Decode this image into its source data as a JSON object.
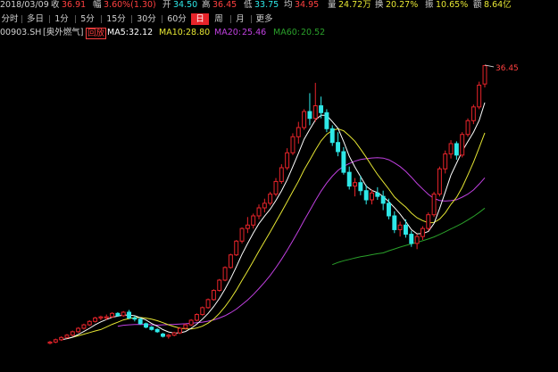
{
  "quote": {
    "date": "2018/03/09",
    "close_label": "收",
    "close": "36.91",
    "change_label": "幅",
    "change": "3.60%(1.30)",
    "open_label": "开",
    "open": "34.50",
    "high_label": "高",
    "high": "36.45",
    "low_label": "低",
    "low": "33.75",
    "avg_label": "均",
    "avg": "34.95",
    "volume_label": "量",
    "volume": "24.72万",
    "turnover_label": "换",
    "turnover": "20.27%",
    "amplitude_label": "振",
    "amplitude": "10.65%",
    "amount_label": "额",
    "amount": "8.64亿"
  },
  "periods": [
    {
      "label": "分时"
    },
    {
      "label": "多日"
    },
    {
      "label": "1分"
    },
    {
      "label": "5分"
    },
    {
      "label": "15分"
    },
    {
      "label": "30分"
    },
    {
      "label": "60分"
    },
    {
      "label": "日",
      "active": true
    },
    {
      "label": "周"
    },
    {
      "label": "月"
    },
    {
      "label": "更多"
    }
  ],
  "info": {
    "code": "00903.SH",
    "name": "[奥外燃气]",
    "tag": "回放",
    "ma5_label": "MA5:",
    "ma5": "32.12",
    "ma10_label": "MA10:",
    "ma10": "28.80",
    "ma20_label": "MA20:",
    "ma20": "25.46",
    "ma60_label": "MA60:",
    "ma60": "20.52"
  },
  "colors": {
    "up": "#e8242a",
    "down": "#2ee8e8",
    "ma5": "#ffffff",
    "ma10": "#e6e633",
    "ma20": "#c040e0",
    "ma60": "#2aa02a",
    "label_red": "#ff4040"
  },
  "chart_data": {
    "type": "candlestick",
    "title": "",
    "xlabel": "",
    "ylabel": "",
    "ylim": [
      10,
      38
    ],
    "annotation": "36.45",
    "candles": [
      [
        12.2,
        12.4,
        12.1,
        12.3
      ],
      [
        12.3,
        12.6,
        12.2,
        12.5
      ],
      [
        12.5,
        12.8,
        12.4,
        12.7
      ],
      [
        12.7,
        13.0,
        12.6,
        12.9
      ],
      [
        12.9,
        13.3,
        12.8,
        13.2
      ],
      [
        13.2,
        13.6,
        13.1,
        13.5
      ],
      [
        13.5,
        13.9,
        13.4,
        13.8
      ],
      [
        13.8,
        14.2,
        13.7,
        14.1
      ],
      [
        14.1,
        14.5,
        14.0,
        14.4
      ],
      [
        14.4,
        14.6,
        14.2,
        14.5
      ],
      [
        14.4,
        14.7,
        14.2,
        14.5
      ],
      [
        14.5,
        14.9,
        14.4,
        14.8
      ],
      [
        14.8,
        14.9,
        14.5,
        14.6
      ],
      [
        14.6,
        15.0,
        14.5,
        14.9
      ],
      [
        14.9,
        15.1,
        14.3,
        14.4
      ],
      [
        14.4,
        14.6,
        14.1,
        14.3
      ],
      [
        14.3,
        14.4,
        13.8,
        13.9
      ],
      [
        13.9,
        14.0,
        13.5,
        13.6
      ],
      [
        13.6,
        13.7,
        13.3,
        13.4
      ],
      [
        13.4,
        13.5,
        13.1,
        13.2
      ],
      [
        13.0,
        13.1,
        12.7,
        12.8
      ],
      [
        12.8,
        13.0,
        12.6,
        12.9
      ],
      [
        12.9,
        13.2,
        12.8,
        13.1
      ],
      [
        13.1,
        13.6,
        13.0,
        13.5
      ],
      [
        13.5,
        13.9,
        13.4,
        13.8
      ],
      [
        13.8,
        14.3,
        13.7,
        14.2
      ],
      [
        14.2,
        14.8,
        14.1,
        14.7
      ],
      [
        14.7,
        15.4,
        14.6,
        15.3
      ],
      [
        15.3,
        16.1,
        15.2,
        16.0
      ],
      [
        16.0,
        16.9,
        15.9,
        16.8
      ],
      [
        16.8,
        17.8,
        16.7,
        17.7
      ],
      [
        17.7,
        18.9,
        17.6,
        18.8
      ],
      [
        18.8,
        20.0,
        18.7,
        19.9
      ],
      [
        19.9,
        21.2,
        19.8,
        21.1
      ],
      [
        21.1,
        22.3,
        20.9,
        22.2
      ],
      [
        22.2,
        23.2,
        21.8,
        22.5
      ],
      [
        22.5,
        23.5,
        22.2,
        23.3
      ],
      [
        23.3,
        24.3,
        23.0,
        24.0
      ],
      [
        24.0,
        24.8,
        23.6,
        24.4
      ],
      [
        24.4,
        25.4,
        24.2,
        25.2
      ],
      [
        25.2,
        26.6,
        25.0,
        26.3
      ],
      [
        26.3,
        27.8,
        26.1,
        27.5
      ],
      [
        27.5,
        29.2,
        27.3,
        28.8
      ],
      [
        28.8,
        30.5,
        28.6,
        30.2
      ],
      [
        30.2,
        31.5,
        29.6,
        31.0
      ],
      [
        31.0,
        32.6,
        30.8,
        32.4
      ],
      [
        32.4,
        34.0,
        31.2,
        31.8
      ],
      [
        31.8,
        34.9,
        31.5,
        32.9
      ],
      [
        32.9,
        33.7,
        31.8,
        32.3
      ],
      [
        32.3,
        32.6,
        30.6,
        30.9
      ],
      [
        30.9,
        31.2,
        29.4,
        29.7
      ],
      [
        29.7,
        30.6,
        28.5,
        28.9
      ],
      [
        28.9,
        29.3,
        26.9,
        27.1
      ],
      [
        27.1,
        27.6,
        25.6,
        25.9
      ],
      [
        25.9,
        26.6,
        25.0,
        26.2
      ],
      [
        26.2,
        26.8,
        25.1,
        25.5
      ],
      [
        25.5,
        26.0,
        24.3,
        24.7
      ],
      [
        24.7,
        25.6,
        24.3,
        25.3
      ],
      [
        25.3,
        25.8,
        24.7,
        25.0
      ],
      [
        25.0,
        25.5,
        23.8,
        24.4
      ],
      [
        24.4,
        24.8,
        23.0,
        23.3
      ],
      [
        23.3,
        23.7,
        21.8,
        22.1
      ],
      [
        22.1,
        22.8,
        21.5,
        22.5
      ],
      [
        22.5,
        23.0,
        21.4,
        21.7
      ],
      [
        21.7,
        22.0,
        20.6,
        20.9
      ],
      [
        20.9,
        21.7,
        20.4,
        21.5
      ],
      [
        21.5,
        22.4,
        21.2,
        22.2
      ],
      [
        22.2,
        23.6,
        22.0,
        23.4
      ],
      [
        23.4,
        25.4,
        23.2,
        25.2
      ],
      [
        25.2,
        27.6,
        25.0,
        27.4
      ],
      [
        27.4,
        29.0,
        27.0,
        28.7
      ],
      [
        28.7,
        29.9,
        28.3,
        29.6
      ],
      [
        29.6,
        29.8,
        28.2,
        28.6
      ],
      [
        28.6,
        30.6,
        28.4,
        30.4
      ],
      [
        30.4,
        31.8,
        30.2,
        31.6
      ],
      [
        31.6,
        33.0,
        31.3,
        32.8
      ],
      [
        32.8,
        35.0,
        32.6,
        34.7
      ],
      [
        34.8,
        36.45,
        34.5,
        36.4
      ]
    ]
  }
}
